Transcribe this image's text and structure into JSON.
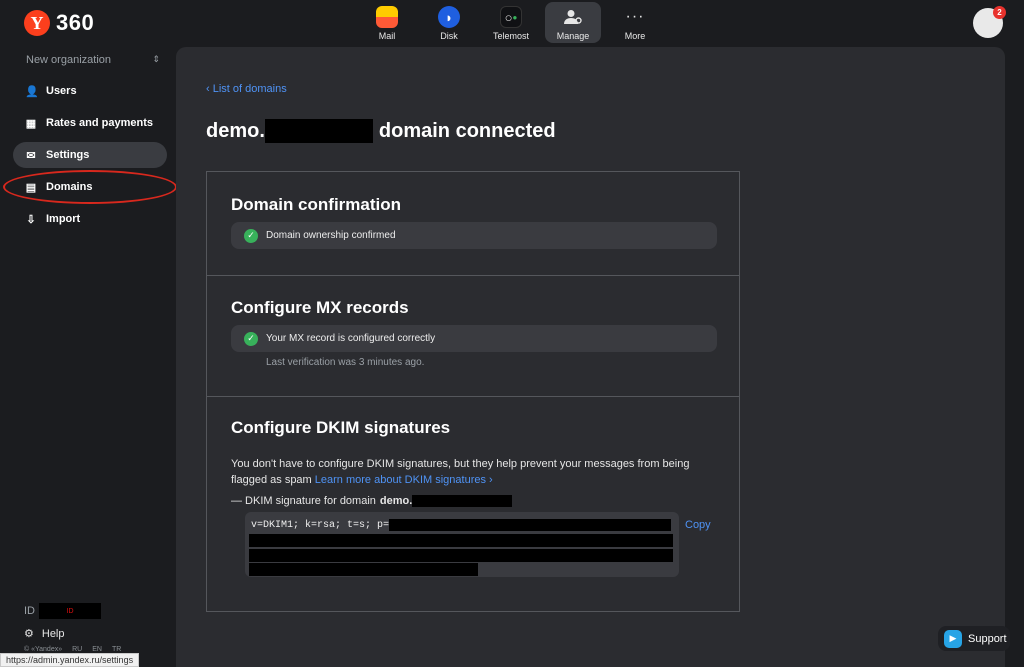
{
  "header": {
    "logo_letter": "Y",
    "logo_text": "360",
    "nav": [
      {
        "label": "Mail",
        "icon": "mail-icon"
      },
      {
        "label": "Disk",
        "icon": "disk-icon"
      },
      {
        "label": "Telemost",
        "icon": "telemost-icon"
      },
      {
        "label": "Manage",
        "icon": "manage-icon",
        "active": true
      },
      {
        "label": "More",
        "icon": "more-icon"
      }
    ],
    "avatar_badge": "2"
  },
  "sidebar": {
    "org_name": "New organization",
    "items": [
      {
        "label": "Users",
        "icon": "user-icon"
      },
      {
        "label": "Rates and payments",
        "icon": "grid-icon"
      },
      {
        "label": "Settings",
        "icon": "envelope-icon",
        "active": true
      },
      {
        "label": "Domains",
        "icon": "domains-icon"
      },
      {
        "label": "Import",
        "icon": "import-icon"
      }
    ],
    "id_label": "ID",
    "id_redacted": "ID",
    "help_label": "Help",
    "copyright": "© «Yandex»",
    "langs": [
      "RU",
      "EN",
      "TR"
    ]
  },
  "statusbar_url": "https://admin.yandex.ru/settings",
  "main": {
    "back_link": "List of domains",
    "title_prefix": "demo.",
    "title_suffix": "domain connected",
    "sections": {
      "confirmation": {
        "title": "Domain confirmation",
        "status": "Domain ownership confirmed"
      },
      "mx": {
        "title": "Configure MX records",
        "status": "Your MX record is configured correctly",
        "last_check": "Last verification was 3 minutes ago."
      },
      "dkim": {
        "title": "Configure DKIM signatures",
        "desc": "You don't have to configure DKIM signatures, but they help prevent your messages from being flagged as spam",
        "learn_more": "Learn more about DKIM signatures",
        "signature_label": "— DKIM signature for domain",
        "signature_domain": "demo.",
        "signature_value": "v=DKIM1; k=rsa; t=s; p=",
        "copy_label": "Copy"
      }
    }
  },
  "support_label": "Support",
  "colors": {
    "accent": "#4f93f5",
    "success": "#38b15b",
    "brand": "#fc3f1d",
    "highlight": "#d8281d"
  }
}
